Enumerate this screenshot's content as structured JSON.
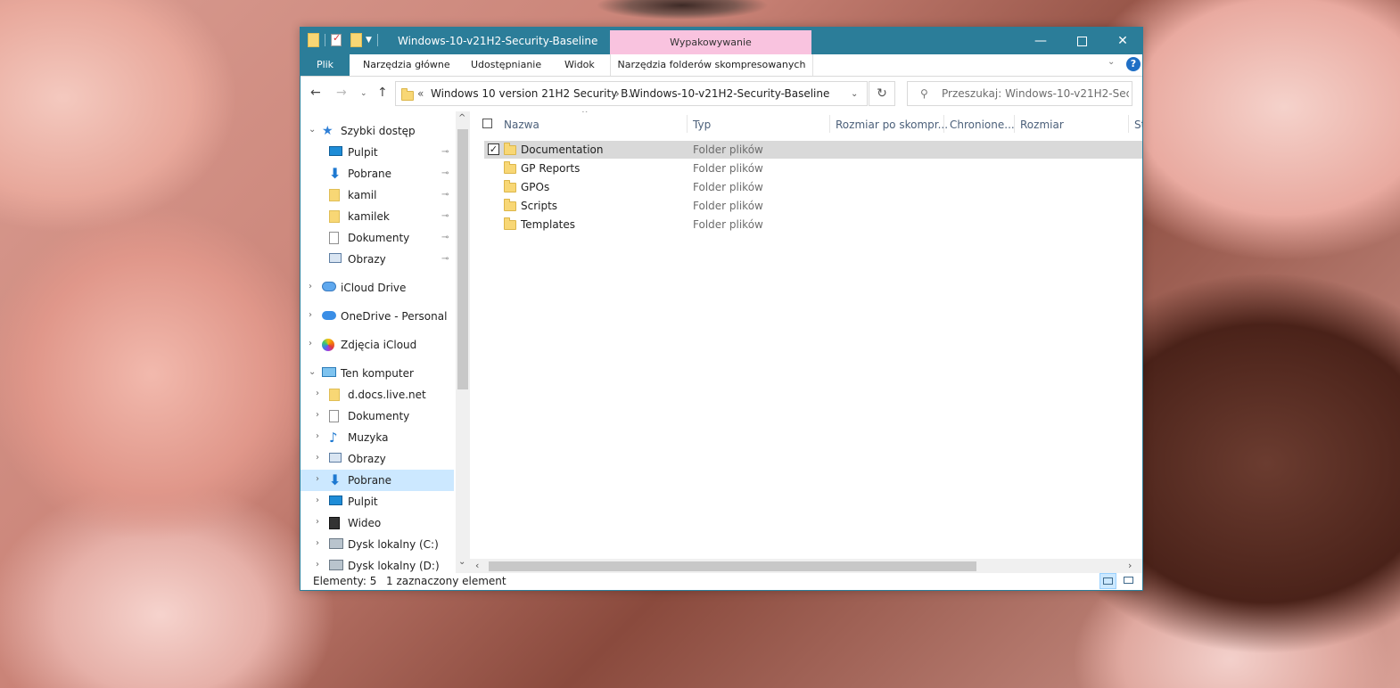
{
  "window": {
    "title": "Windows-10-v21H2-Security-Baseline",
    "context_tab_group": "Wypakowywanie",
    "controls": {
      "minimize": "—",
      "close": "✕"
    }
  },
  "ribbon": {
    "file_tab": "Plik",
    "tabs": [
      "Narzędzia główne",
      "Udostępnianie",
      "Widok"
    ],
    "context_tab": "Narzędzia folderów skompresowanych",
    "collapse_glyph": "⌄",
    "help": "?"
  },
  "address": {
    "overflow": "«",
    "crumbs": [
      "Windows 10 version 21H2 Security B...",
      "Windows-10-v21H2-Security-Baseline"
    ],
    "separator": "›",
    "dropdown": "⌄",
    "refresh": "↻"
  },
  "search": {
    "placeholder": "Przeszukaj: Windows-10-v21H2-Securi..."
  },
  "nav_buttons": {
    "back": "←",
    "forward": "→",
    "recent": "⌄",
    "up": "↑"
  },
  "navpane": {
    "items": [
      {
        "label": "Szybki dostęp",
        "icon": "quick-access-star-icon",
        "expander": "⌄",
        "level": 0,
        "pinned": false
      },
      {
        "label": "Pulpit",
        "icon": "desktop-icon",
        "expander": "",
        "level": 1,
        "pinned": true
      },
      {
        "label": "Pobrane",
        "icon": "download-icon",
        "expander": "",
        "level": 1,
        "pinned": true
      },
      {
        "label": "kamil",
        "icon": "folder-icon",
        "expander": "",
        "level": 1,
        "pinned": true
      },
      {
        "label": "kamilek",
        "icon": "folder-icon",
        "expander": "",
        "level": 1,
        "pinned": true
      },
      {
        "label": "Dokumenty",
        "icon": "documents-icon",
        "expander": "",
        "level": 1,
        "pinned": true
      },
      {
        "label": "Obrazy",
        "icon": "pictures-icon",
        "expander": "",
        "level": 1,
        "pinned": true
      },
      {
        "label": "iCloud Drive",
        "icon": "icloud-drive-icon",
        "expander": "›",
        "level": 0,
        "pinned": false
      },
      {
        "label": "OneDrive - Personal",
        "icon": "onedrive-icon",
        "expander": "›",
        "level": 0,
        "pinned": false
      },
      {
        "label": "Zdjęcia iCloud",
        "icon": "icloud-photos-icon",
        "expander": "›",
        "level": 0,
        "pinned": false
      },
      {
        "label": "Ten komputer",
        "icon": "this-pc-icon",
        "expander": "⌄",
        "level": 0,
        "pinned": false
      },
      {
        "label": "d.docs.live.net",
        "icon": "folder-icon",
        "expander": "›",
        "level": 1,
        "pinned": false
      },
      {
        "label": "Dokumenty",
        "icon": "documents-icon",
        "expander": "›",
        "level": 1,
        "pinned": false
      },
      {
        "label": "Muzyka",
        "icon": "music-icon",
        "expander": "›",
        "level": 1,
        "pinned": false
      },
      {
        "label": "Obrazy",
        "icon": "pictures-icon",
        "expander": "›",
        "level": 1,
        "pinned": false
      },
      {
        "label": "Pobrane",
        "icon": "download-icon",
        "expander": "›",
        "level": 1,
        "pinned": false,
        "selected": true
      },
      {
        "label": "Pulpit",
        "icon": "desktop-icon",
        "expander": "›",
        "level": 1,
        "pinned": false
      },
      {
        "label": "Wideo",
        "icon": "video-icon",
        "expander": "›",
        "level": 1,
        "pinned": false
      },
      {
        "label": "Dysk lokalny (C:)",
        "icon": "local-disk-icon",
        "expander": "›",
        "level": 1,
        "pinned": false
      },
      {
        "label": "Dysk lokalny (D:)",
        "icon": "local-disk-icon",
        "expander": "›",
        "level": 1,
        "pinned": false
      }
    ],
    "pin_glyph": "📌"
  },
  "file_list": {
    "columns": [
      "Nazwa",
      "Typ",
      "Rozmiar po skompr...",
      "Chronione...",
      "Rozmiar",
      "St"
    ],
    "rows": [
      {
        "name": "Documentation",
        "type": "Folder plików",
        "checked": true,
        "selected": true
      },
      {
        "name": "GP Reports",
        "type": "Folder plików",
        "checked": false,
        "selected": false
      },
      {
        "name": "GPOs",
        "type": "Folder plików",
        "checked": false,
        "selected": false
      },
      {
        "name": "Scripts",
        "type": "Folder plików",
        "checked": false,
        "selected": false
      },
      {
        "name": "Templates",
        "type": "Folder plików",
        "checked": false,
        "selected": false
      }
    ],
    "check_glyph": "✓"
  },
  "status": {
    "count": "Elementy: 5",
    "selection": "1 zaznaczony element"
  },
  "colors": {
    "titlebar": "#2b7d99",
    "context_tab": "#f9c3df",
    "selected_nav": "#cce8ff",
    "selected_row": "#d9d9d9",
    "folder": "#f8d775"
  }
}
